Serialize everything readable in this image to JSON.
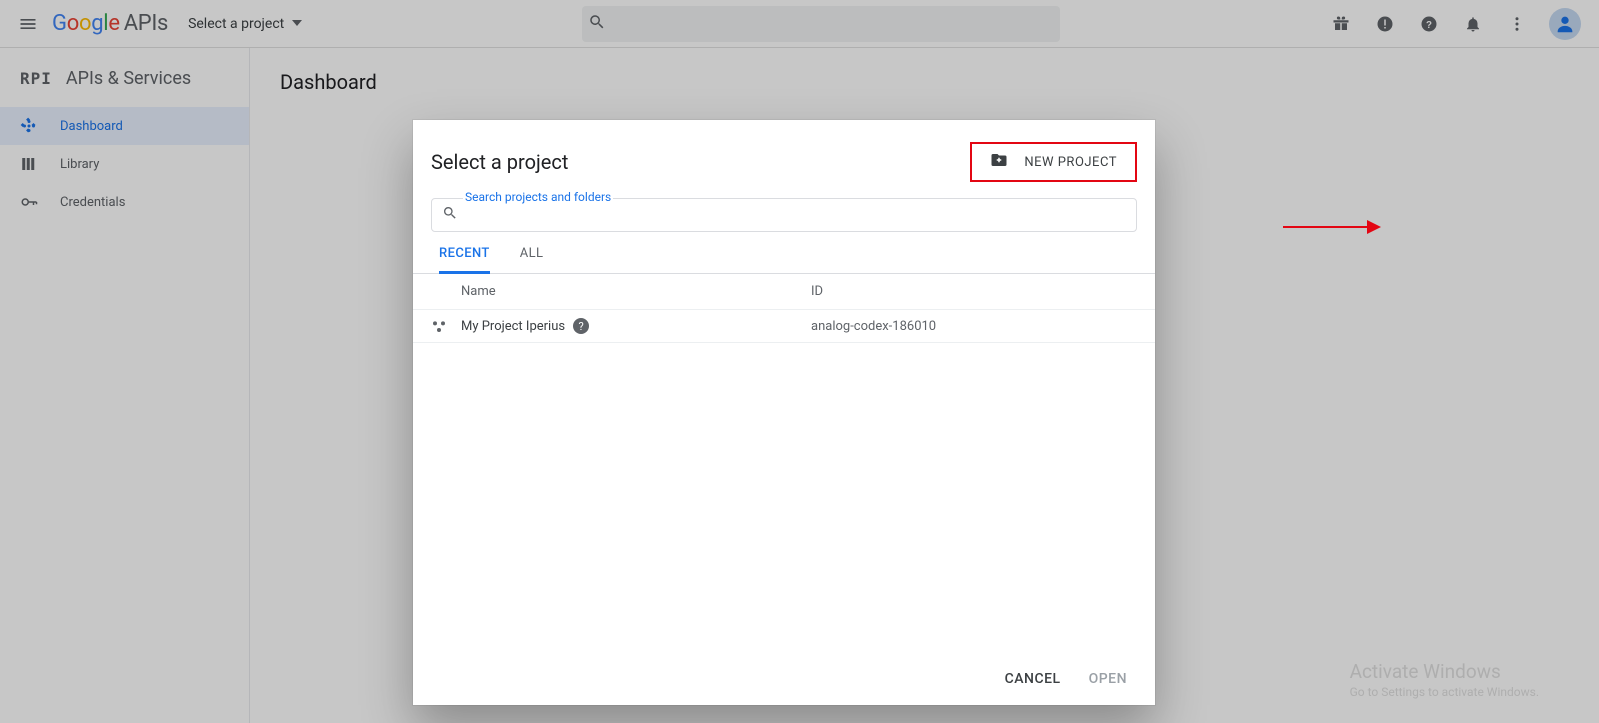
{
  "header": {
    "logo_brand": "Google",
    "logo_suffix": "APIs",
    "project_selector": "Select a project"
  },
  "sidebar": {
    "section_icon": "RPI",
    "section_title": "APIs & Services",
    "items": [
      {
        "label": "Dashboard"
      },
      {
        "label": "Library"
      },
      {
        "label": "Credentials"
      }
    ]
  },
  "main": {
    "page_title": "Dashboard"
  },
  "dialog": {
    "title": "Select a project",
    "new_project_label": "NEW PROJECT",
    "search_label": "Search projects and folders",
    "tabs": {
      "recent": "RECENT",
      "all": "ALL"
    },
    "columns": {
      "name": "Name",
      "id": "ID"
    },
    "rows": [
      {
        "name": "My Project Iperius",
        "id": "analog-codex-186010"
      }
    ],
    "footer": {
      "cancel": "CANCEL",
      "open": "OPEN"
    }
  },
  "watermark": {
    "title": "Activate Windows",
    "sub": "Go to Settings to activate Windows."
  }
}
